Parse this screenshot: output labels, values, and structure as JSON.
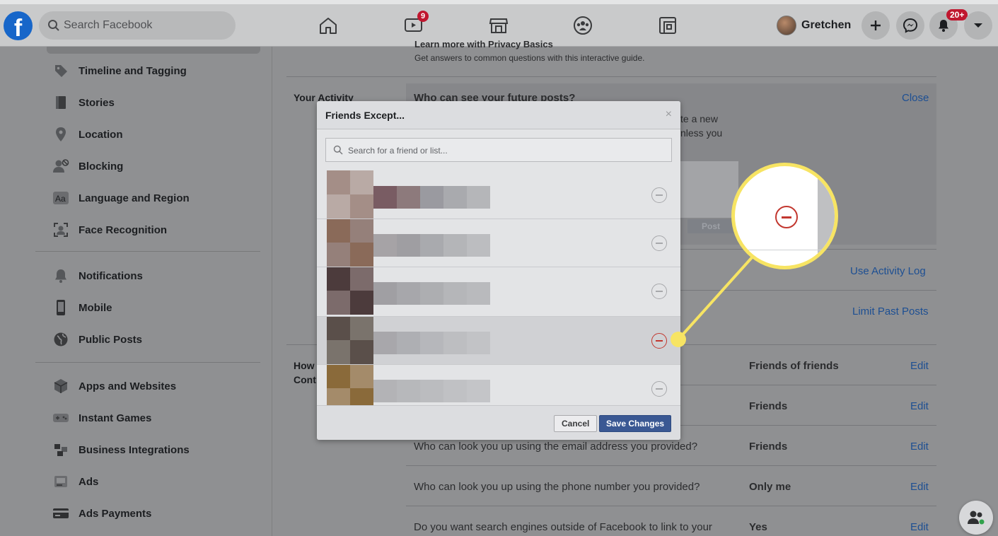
{
  "topbar": {
    "logo": "f",
    "search_placeholder": "Search Facebook",
    "watch_badge": "9",
    "profile_name": "Gretchen",
    "notifications_badge": "20+"
  },
  "sidebar": {
    "items": [
      {
        "label": "Timeline and Tagging",
        "icon": "tag-icon"
      },
      {
        "label": "Stories",
        "icon": "book-icon"
      },
      {
        "label": "Location",
        "icon": "location-pin-icon"
      },
      {
        "label": "Blocking",
        "icon": "block-user-icon"
      },
      {
        "label": "Language and Region",
        "icon": "language-icon"
      },
      {
        "label": "Face Recognition",
        "icon": "face-scan-icon"
      },
      {
        "label": "Notifications",
        "icon": "bell-icon"
      },
      {
        "label": "Mobile",
        "icon": "mobile-icon"
      },
      {
        "label": "Public Posts",
        "icon": "globe-icon"
      },
      {
        "label": "Apps and Websites",
        "icon": "cube-icon"
      },
      {
        "label": "Instant Games",
        "icon": "gamepad-icon"
      },
      {
        "label": "Business Integrations",
        "icon": "integrations-icon"
      },
      {
        "label": "Ads",
        "icon": "ads-icon"
      },
      {
        "label": "Ads Payments",
        "icon": "credit-card-icon"
      }
    ]
  },
  "main": {
    "privacy_basics_title": "Learn more with Privacy Basics",
    "privacy_basics_desc": "Get answers to common questions with this interactive guide.",
    "your_activity_label": "Your Activity",
    "future_posts_question": "Who can see your future posts?",
    "close_link": "Close",
    "partial_text_1": "te a new",
    "partial_text_2": "nless you",
    "post_button": "Post",
    "use_activity_log": "Use Activity Log",
    "limit_past_posts": "Limit Past Posts",
    "how_label_1": "How",
    "how_label_2": "Cont",
    "rows": [
      {
        "question": "",
        "value": "Friends of friends",
        "action": "Edit"
      },
      {
        "question": "",
        "value": "Friends",
        "action": "Edit"
      },
      {
        "question": "Who can look you up using the email address you provided?",
        "value": "Friends",
        "action": "Edit"
      },
      {
        "question": "Who can look you up using the phone number you provided?",
        "value": "Only me",
        "action": "Edit"
      },
      {
        "question": "Do you want search engines outside of Facebook to link to your",
        "value": "Yes",
        "action": "Edit"
      }
    ]
  },
  "modal": {
    "title": "Friends Except...",
    "close_symbol": "×",
    "search_placeholder": "Search for a friend or list...",
    "cancel": "Cancel",
    "save": "Save Changes",
    "friends_count": 5,
    "highlighted_index": 3
  },
  "colors": {
    "accent": "#1766c9",
    "link": "#1d4f93",
    "save_button": "#3a5893",
    "callout": "#f7e463",
    "remove_red": "#c2372f",
    "badge": "#c0172f"
  }
}
